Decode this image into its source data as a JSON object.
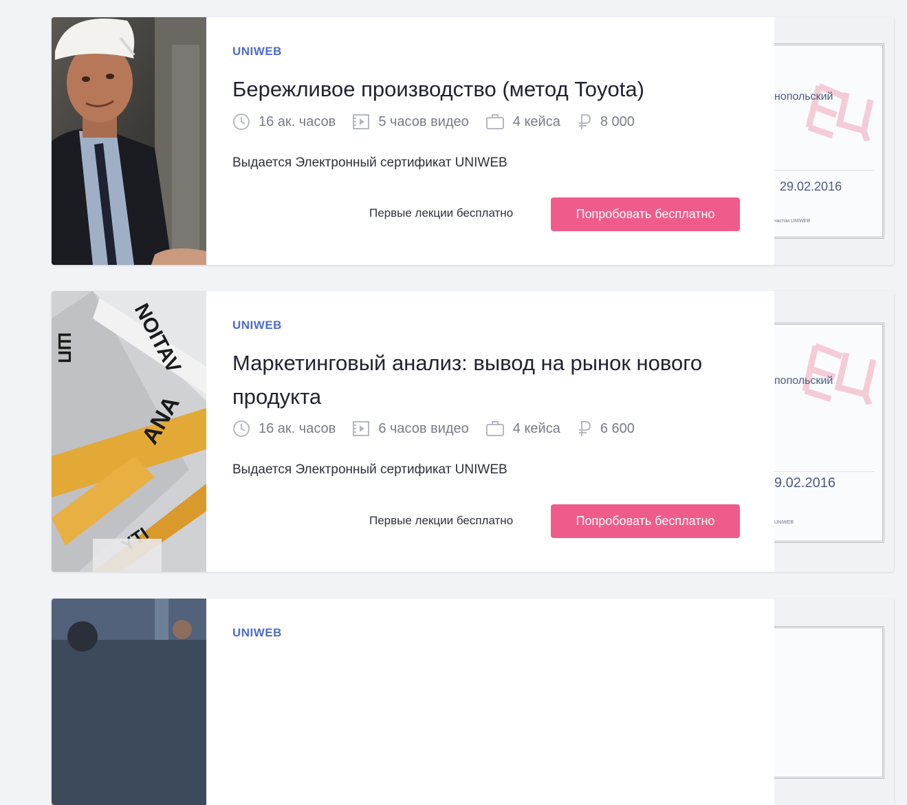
{
  "courses": [
    {
      "provider": "UNIWEB",
      "title": "Бережливое производство (метод Toyota)",
      "meta": {
        "hours": "16 ак. часов",
        "video": "5 часов видео",
        "cases": "4 кейса",
        "price": "8 000"
      },
      "certificate_note": "Выдается Электронный сертификат UNIWEB",
      "free_note": "Первые лекции бесплатно",
      "cta_label": "Попробовать бесплатно",
      "cert_preview": {
        "name": "нопольский",
        "date": "29.02.2016",
        "small": "частии UNIWEB"
      }
    },
    {
      "provider": "UNIWEB",
      "title": "Маркетинговый анализ: вывод на рынок нового продукта",
      "meta": {
        "hours": "16 ак. часов",
        "video": "6 часов видео",
        "cases": "4 кейса",
        "price": "6 600"
      },
      "certificate_note": "Выдается Электронный сертификат UNIWEB",
      "free_note": "Первые лекции бесплатно",
      "cta_label": "Попробовать бесплатно",
      "cert_preview": {
        "name": "попольский",
        "date": "9.02.2016",
        "small": "UNIWEB"
      }
    },
    {
      "provider": "UNIWEB"
    }
  ],
  "colors": {
    "brand": "#4d6bcf",
    "cta": "#ef5c8b",
    "page_bg": "#f2f3f7",
    "meta_text": "#777b85"
  },
  "icons": [
    "clock-icon",
    "video-icon",
    "briefcase-icon",
    "ruble-icon"
  ]
}
